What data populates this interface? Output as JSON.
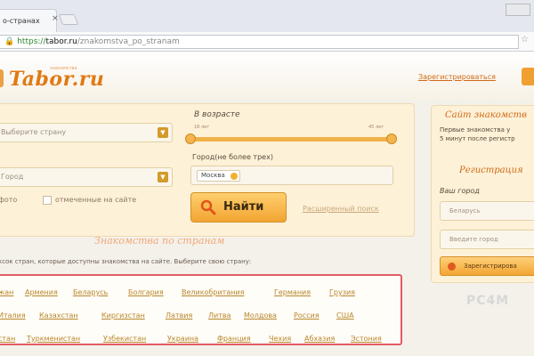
{
  "browser": {
    "tab_title": "о-странах",
    "tab_close": "×",
    "url_scheme": "https://",
    "url_host": "tabor.ru",
    "url_path": "/znakomstva_po_stranam"
  },
  "header": {
    "logo_text": "Tabor.ru",
    "logo_tagline": "знакомства",
    "register_link": "Зарегистрироваться"
  },
  "search": {
    "country_select": "Выберите страну",
    "city_select": "Город",
    "checkbox1_label": "фото",
    "checkbox2_label": "отмеченные на сайте",
    "age_label": "В возрасте",
    "age_min": "18 лет",
    "age_max": "45 лет",
    "city_label": "Город(не более трех)",
    "city_chip": "Москва",
    "find_button": "Найти",
    "extended_search": "Расширенный поиск"
  },
  "countries_section": {
    "title": "Знакомства по странам",
    "description": "ксок стран, которые доступны знакомства на сайте. Выберите свою страну:",
    "rows": [
      [
        "жан",
        "Армения",
        "Беларусь",
        "Болгария",
        "Великобритания",
        "Германия",
        "Грузия"
      ],
      [
        "Италия",
        "Казахстан",
        "Киргизстан",
        "Латвия",
        "Литва",
        "Молдова",
        "Россия",
        "США"
      ],
      [
        "стан",
        "Туркменистан",
        "Узбекистан",
        "Украина",
        "Франция",
        "Чехия",
        "Абхазия",
        "Эстония"
      ]
    ]
  },
  "sidebar": {
    "title": "Сайт знакомств",
    "text_line1": "Первые знакомства у",
    "text_line2": "5 минут после регистр",
    "reg_title": "Регистрация",
    "city_label": "Ваш город",
    "country_field": "Беларусь",
    "city_field": "Введите город",
    "register_button": "Зарегистрирова"
  },
  "watermark": "PC4M"
}
